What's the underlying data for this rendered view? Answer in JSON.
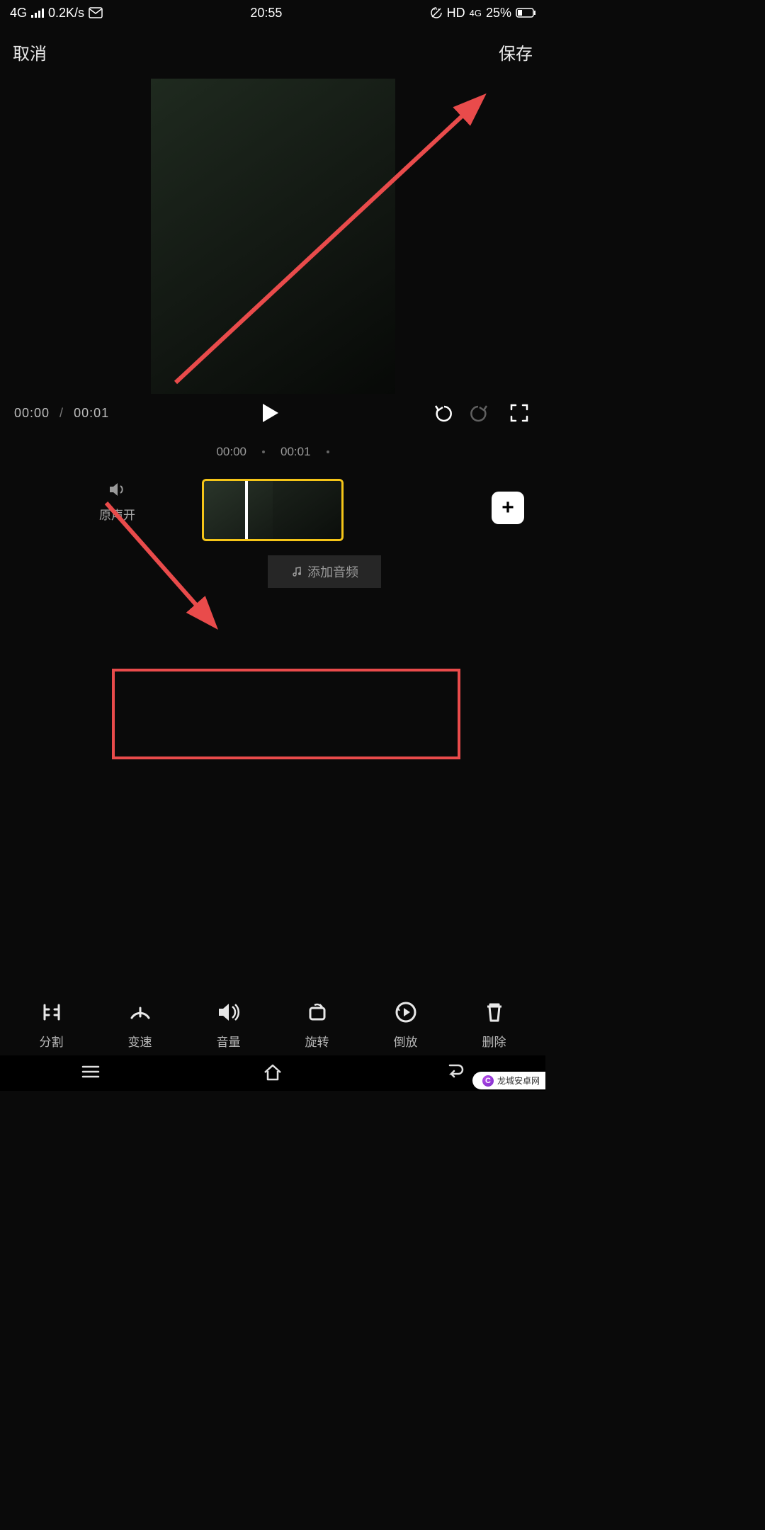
{
  "status": {
    "network": "4G",
    "speed": "0.2K/s",
    "time": "20:55",
    "hd": "HD",
    "net2": "4G",
    "battery_pct": "25%"
  },
  "topbar": {
    "cancel": "取消",
    "save": "保存"
  },
  "playback": {
    "current": "00:00",
    "total": "00:01"
  },
  "ruler": {
    "t0": "00:00",
    "t1": "00:01"
  },
  "timeline": {
    "original_sound": "原声开",
    "add_audio": "添加音频",
    "add_symbol": "+"
  },
  "tools": {
    "split": "分割",
    "speed": "变速",
    "volume": "音量",
    "rotate": "旋转",
    "reverse": "倒放",
    "delete": "删除"
  },
  "watermark": {
    "text": "龙城安卓网"
  }
}
